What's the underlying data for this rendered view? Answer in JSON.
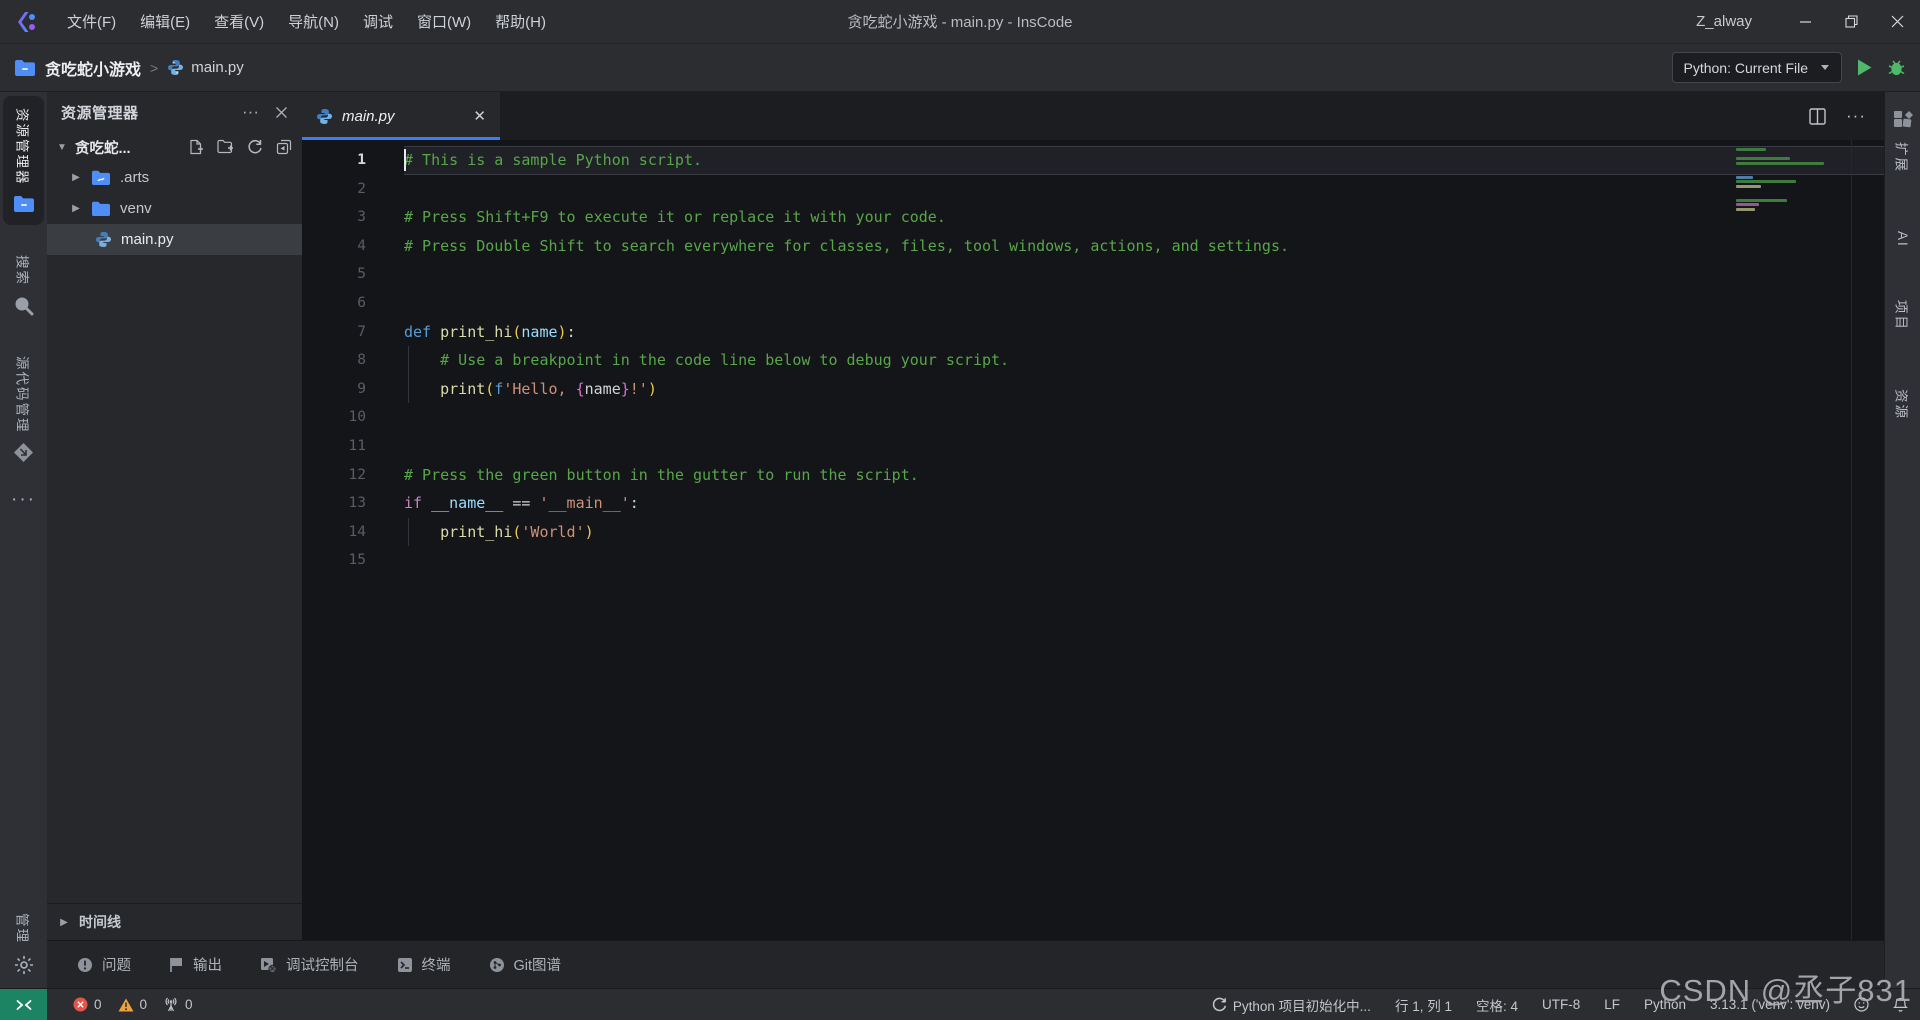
{
  "titlebar": {
    "menus": [
      "文件(F)",
      "编辑(E)",
      "查看(V)",
      "导航(N)",
      "调试",
      "窗口(W)",
      "帮助(H)"
    ],
    "title": "贪吃蛇小游戏 - main.py - InsCode",
    "user": "Z_alway"
  },
  "toolbar": {
    "project": "贪吃蛇小游戏",
    "separator": ">",
    "file": "main.py",
    "run_config": "Python: Current File"
  },
  "activitybar": {
    "explorer": "资源管理器",
    "search": "搜索",
    "scm": "源代码管理",
    "more": "···",
    "manage": "管理"
  },
  "sidebar": {
    "header": "资源管理器",
    "project": "贪吃蛇...",
    "tree": [
      {
        "name": ".arts"
      },
      {
        "name": "venv"
      },
      {
        "name": "main.py"
      }
    ],
    "timeline": "时间线"
  },
  "editor": {
    "tab": "main.py",
    "lines": [
      {
        "n": 1,
        "current": true,
        "tokens": [
          [
            "comment",
            "# This is a sample Python script."
          ]
        ]
      },
      {
        "n": 2,
        "tokens": []
      },
      {
        "n": 3,
        "tokens": [
          [
            "comment",
            "# Press Shift+F9 to execute it or replace it with your code."
          ]
        ]
      },
      {
        "n": 4,
        "tokens": [
          [
            "comment",
            "# Press Double Shift to search everywhere for classes, files, tool windows, actions, and settings."
          ]
        ]
      },
      {
        "n": 5,
        "tokens": []
      },
      {
        "n": 6,
        "tokens": []
      },
      {
        "n": 7,
        "tokens": [
          [
            "kw",
            "def"
          ],
          [
            "plain",
            " "
          ],
          [
            "fn",
            "print_hi"
          ],
          [
            "paren",
            "("
          ],
          [
            "param",
            "name"
          ],
          [
            "paren",
            ")"
          ],
          [
            "plain",
            ":"
          ]
        ]
      },
      {
        "n": 8,
        "guide": true,
        "tokens": [
          [
            "plain",
            "    "
          ],
          [
            "comment",
            "# Use a breakpoint in the code line below to debug your script."
          ]
        ]
      },
      {
        "n": 9,
        "guide": true,
        "tokens": [
          [
            "plain",
            "    "
          ],
          [
            "fn",
            "print"
          ],
          [
            "paren",
            "("
          ],
          [
            "kw",
            "f"
          ],
          [
            "str",
            "'Hello, "
          ],
          [
            "brace",
            "{"
          ],
          [
            "plain",
            "name"
          ],
          [
            "brace",
            "}"
          ],
          [
            "str",
            "!'"
          ],
          [
            "paren",
            ")"
          ]
        ]
      },
      {
        "n": 10,
        "tokens": []
      },
      {
        "n": 11,
        "tokens": []
      },
      {
        "n": 12,
        "tokens": [
          [
            "comment",
            "# Press the green button in the gutter to run the script."
          ]
        ]
      },
      {
        "n": 13,
        "run": true,
        "tokens": [
          [
            "kw2",
            "if"
          ],
          [
            "plain",
            " "
          ],
          [
            "param",
            "__name__"
          ],
          [
            "plain",
            " == "
          ],
          [
            "str",
            "'__main__'"
          ],
          [
            "plain",
            ":"
          ]
        ]
      },
      {
        "n": 14,
        "guide": true,
        "tokens": [
          [
            "plain",
            "    "
          ],
          [
            "fn",
            "print_hi"
          ],
          [
            "paren",
            "("
          ],
          [
            "str",
            "'World'"
          ],
          [
            "paren",
            ")"
          ]
        ]
      },
      {
        "n": 15,
        "tokens": []
      }
    ]
  },
  "panel": {
    "tabs": [
      {
        "label": "问题"
      },
      {
        "label": "输出"
      },
      {
        "label": "调试控制台"
      },
      {
        "label": "终端"
      },
      {
        "label": "Git图谱"
      }
    ]
  },
  "rightbar": {
    "items": [
      "扩展",
      "AI",
      "项目",
      "资源"
    ]
  },
  "statusbar": {
    "errors": "0",
    "warnings": "0",
    "ports": "0",
    "task": "Python 项目初始化中...",
    "cursor": "行 1, 列 1",
    "indent": "空格: 4",
    "encoding": "UTF-8",
    "eol": "LF",
    "language": "Python",
    "interpreter": "3.13.1 ('venv': venv)"
  },
  "watermark": "CSDN @丞子831"
}
